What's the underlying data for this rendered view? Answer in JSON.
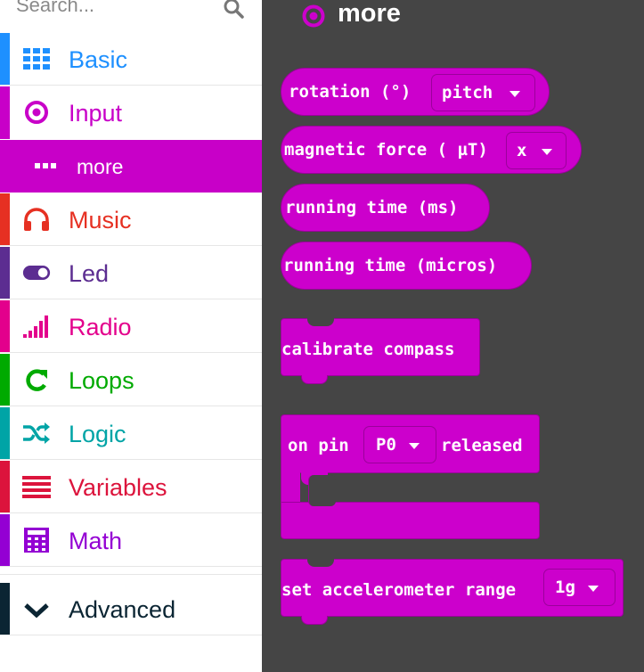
{
  "sidebar": {
    "search": {
      "placeholder": "Search..."
    },
    "categories": [
      {
        "label": "Basic",
        "color": "#1e90ff",
        "icon": "grid-icon"
      },
      {
        "label": "Input",
        "color": "#c800c8",
        "icon": "target-icon"
      },
      {
        "label": "Music",
        "color": "#e63022",
        "icon": "headphones-icon"
      },
      {
        "label": "Led",
        "color": "#5c2d91",
        "icon": "toggle-icon"
      },
      {
        "label": "Radio",
        "color": "#e3008c",
        "icon": "signal-bars-icon"
      },
      {
        "label": "Loops",
        "color": "#00aa00",
        "icon": "refresh-icon"
      },
      {
        "label": "Logic",
        "color": "#00a4a6",
        "icon": "shuffle-icon"
      },
      {
        "label": "Variables",
        "color": "#dc143c",
        "icon": "lines-icon"
      },
      {
        "label": "Math",
        "color": "#9400d3",
        "icon": "calculator-icon"
      },
      {
        "label": "Advanced",
        "color": "#0b2533",
        "icon": "chevron-down-icon"
      }
    ],
    "subcategory": {
      "label": "more",
      "color": "#c800c8",
      "icon": "dots-icon"
    }
  },
  "flyout": {
    "title": "more",
    "blocks": {
      "rotation": {
        "text": "rotation (°)",
        "dropdown": "pitch"
      },
      "magnetic": {
        "text": "magnetic force (  µT)",
        "dropdown": "x"
      },
      "running_ms": {
        "text": "running time (ms)"
      },
      "running_micros": {
        "text": "running time (micros)"
      },
      "calibrate": {
        "text": "calibrate compass"
      },
      "on_pin": {
        "prefix": "on pin",
        "dropdown": "P0",
        "suffix": "released"
      },
      "accelerometer": {
        "text": "set accelerometer  range",
        "dropdown": "1g"
      }
    },
    "block_color": "#cc00cc",
    "background": "#454545"
  }
}
